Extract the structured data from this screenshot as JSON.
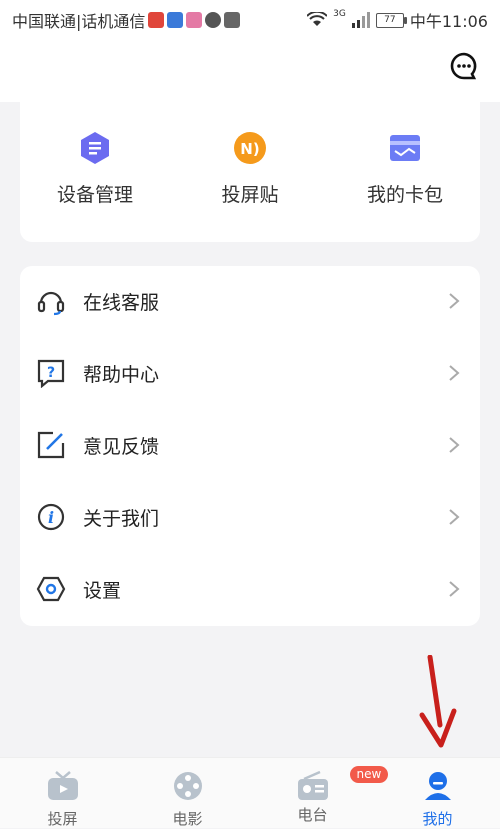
{
  "status_bar": {
    "carrier": "中国联通|话机通信",
    "network_label": "3G",
    "battery": "77",
    "time": "中午11:06"
  },
  "header": {
    "message_icon": "chat-bubble-icon"
  },
  "quick_actions": [
    {
      "label": "设备管理",
      "icon": "device-hexagon-icon",
      "color": "#6b6bf0"
    },
    {
      "label": "投屏贴",
      "icon": "nfc-sticker-icon",
      "color": "#f59a1b"
    },
    {
      "label": "我的卡包",
      "icon": "wallet-icon",
      "color": "#6c7cf5"
    }
  ],
  "menu": [
    {
      "label": "在线客服",
      "icon": "headset-icon"
    },
    {
      "label": "帮助中心",
      "icon": "help-question-icon"
    },
    {
      "label": "意见反馈",
      "icon": "feedback-edit-icon"
    },
    {
      "label": "关于我们",
      "icon": "info-icon"
    },
    {
      "label": "设置",
      "icon": "settings-hexagon-icon"
    }
  ],
  "tabs": [
    {
      "label": "投屏",
      "icon": "tv-icon",
      "active": false
    },
    {
      "label": "电影",
      "icon": "film-reel-icon",
      "active": false
    },
    {
      "label": "电台",
      "icon": "radio-icon",
      "active": false,
      "badge": "new"
    },
    {
      "label": "我的",
      "icon": "profile-icon",
      "active": true
    }
  ],
  "colors": {
    "accent": "#1e6fe8",
    "badge": "#f25a4a",
    "annotation_arrow": "#c8201c"
  }
}
